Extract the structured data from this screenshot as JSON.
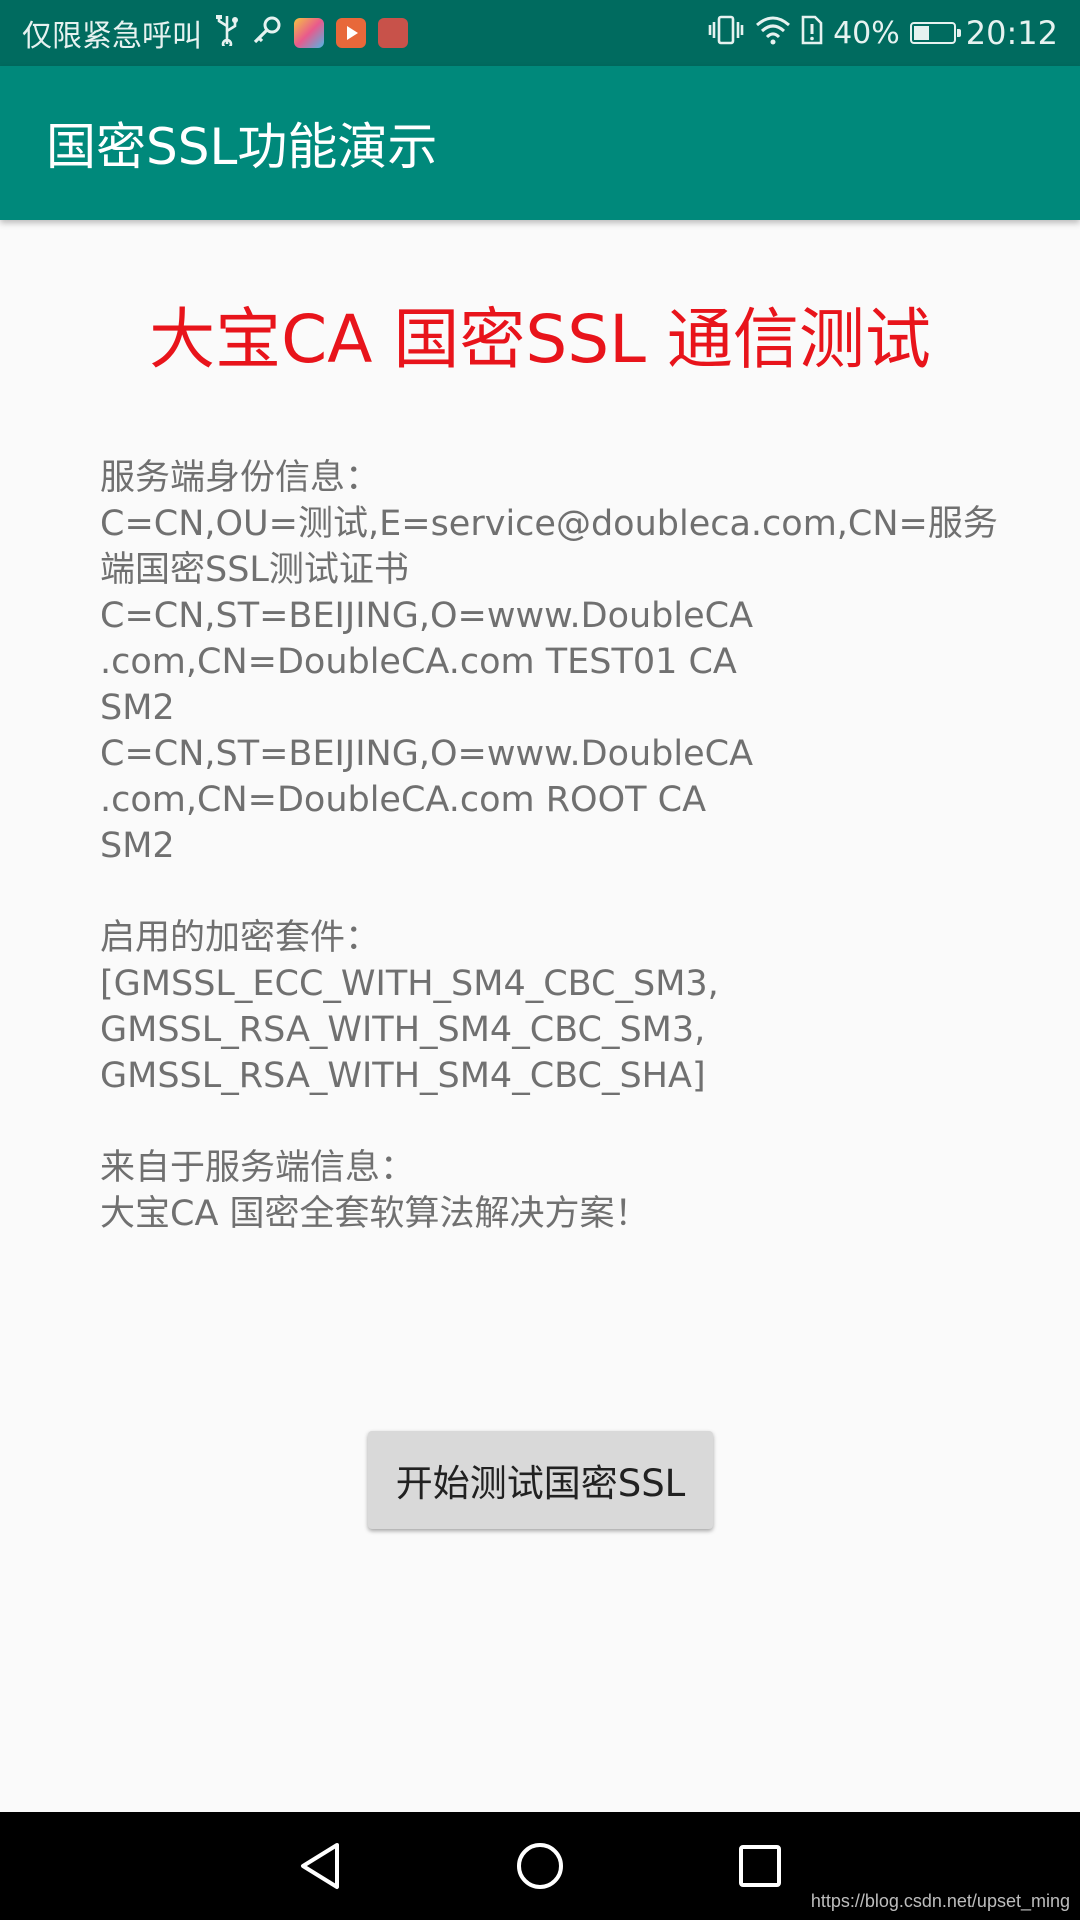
{
  "status_bar": {
    "carrier": "仅限紧急呼叫",
    "battery_text": "40%",
    "battery_level": 0.4,
    "time": "20:12",
    "left_icons": [
      "usb-icon",
      "key-icon",
      "gallery-app-icon",
      "video-app-icon",
      "huawei-app-icon"
    ],
    "right_icons": [
      "vibrate-icon",
      "wifi-icon",
      "sim-alert-icon",
      "battery-icon"
    ]
  },
  "toolbar": {
    "title": "国密SSL功能演示"
  },
  "main": {
    "headline": "大宝CA 国密SSL 通信测试",
    "server_identity_label": "服务端身份信息：",
    "cert_lines": [
      "C=CN,OU=测试,E=service@doubleca.com,CN=服务",
      "端国密SSL测试证书",
      "C=CN,ST=BEIJING,O=www.DoubleCA",
      ".com,CN=DoubleCA.com TEST01 CA",
      "SM2",
      "C=CN,ST=BEIJING,O=www.DoubleCA",
      ".com,CN=DoubleCA.com ROOT CA",
      "SM2"
    ],
    "cipher_label": "启用的加密套件：",
    "cipher_lines": [
      "[GMSSL_ECC_WITH_SM4_CBC_SM3,",
      "GMSSL_RSA_WITH_SM4_CBC_SM3,",
      "GMSSL_RSA_WITH_SM4_CBC_SHA]"
    ],
    "server_msg_label": "来自于服务端信息：",
    "server_msg": "大宝CA 国密全套软算法解决方案！",
    "button_label": "开始测试国密SSL"
  },
  "nav_bar": {
    "icons": [
      "back-icon",
      "home-icon",
      "recents-icon"
    ]
  },
  "watermark": "https://blog.csdn.net/upset_ming",
  "colors": {
    "status_bar": "#006b5f",
    "toolbar": "#00897b",
    "headline": "#e8141b",
    "body_text": "#707070",
    "button": "#d9d9d9"
  }
}
